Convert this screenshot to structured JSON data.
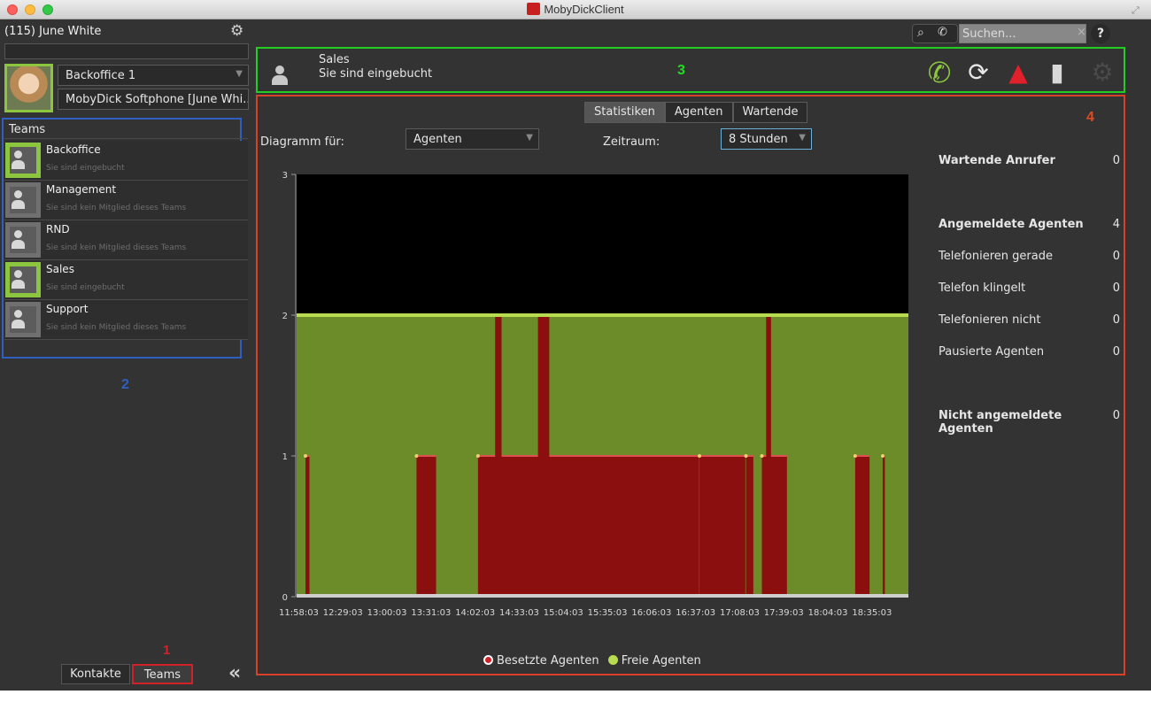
{
  "app": {
    "title": "MobyDickClient"
  },
  "sidebar": {
    "user_name": "(115) June White",
    "group_select": "Backoffice 1",
    "phone_select": "MobyDick Softphone [June Whi...",
    "teams_header": "Teams",
    "teams": [
      {
        "name": "Backoffice",
        "status": "Sie sind eingebucht",
        "active": true
      },
      {
        "name": "Management",
        "status": "Sie sind kein Mitglied dieses Teams",
        "active": false
      },
      {
        "name": "RND",
        "status": "Sie sind kein Mitglied dieses Teams",
        "active": false
      },
      {
        "name": "Sales",
        "status": "Sie sind eingebucht",
        "active": true
      },
      {
        "name": "Support",
        "status": "Sie sind kein Mitglied dieses Teams",
        "active": false
      }
    ],
    "annotation_2": "2",
    "annotation_1": "1",
    "tab_kontakte": "Kontakte",
    "tab_teams": "Teams"
  },
  "toolbar": {
    "search_placeholder": "Suchen...",
    "help": "?"
  },
  "team_panel": {
    "name": "Sales",
    "status": "Sie sind eingebucht",
    "annotation_3": "3"
  },
  "stats_panel": {
    "annotation_4": "4",
    "tabs": [
      "Statistiken",
      "Agenten",
      "Wartende"
    ],
    "active_tab": "Statistiken",
    "diagram_label": "Diagramm für:",
    "diagram_value": "Agenten",
    "range_label": "Zeitraum:",
    "range_value": "8 Stunden",
    "stats": [
      {
        "label": "Wartende Anrufer",
        "value": "0",
        "bold": true
      },
      {
        "label": "Angemeldete Agenten",
        "value": "4",
        "bold": true
      },
      {
        "label": "Telefonieren gerade",
        "value": "0",
        "bold": false
      },
      {
        "label": "Telefon klingelt",
        "value": "0",
        "bold": false
      },
      {
        "label": "Telefonieren nicht",
        "value": "0",
        "bold": false
      },
      {
        "label": "Pausierte Agenten",
        "value": "0",
        "bold": false
      },
      {
        "label": "Nicht angemeldete Agenten",
        "value": "0",
        "bold": true
      }
    ],
    "legend_busy": "Besetzte Agenten",
    "legend_free": "Freie Agenten"
  },
  "chart_data": {
    "type": "area",
    "x_ticks": [
      "11:58:03",
      "12:29:03",
      "13:00:03",
      "13:31:03",
      "14:02:03",
      "14:33:03",
      "15:04:03",
      "15:35:03",
      "16:06:03",
      "16:37:03",
      "17:08:03",
      "17:39:03",
      "18:04:03",
      "18:35:03"
    ],
    "y_ticks": [
      "0",
      "1",
      "2",
      "3"
    ],
    "ylim": [
      0,
      3
    ],
    "colors": {
      "free": "#6b8c28",
      "busy": "#8b0f0f",
      "free_line": "#b8dc50",
      "busy_line": "#e05050"
    },
    "series": [
      {
        "name": "Freie Agenten",
        "constant": 2
      },
      {
        "name": "Besetzte Agenten",
        "segments": [
          [
            0.0145,
            0.021,
            1
          ],
          [
            0.196,
            0.228,
            1
          ],
          [
            0.2965,
            0.658,
            1
          ],
          [
            0.6585,
            0.7335,
            1
          ],
          [
            0.7345,
            0.7465,
            1
          ],
          [
            0.7605,
            0.8015,
            1
          ],
          [
            0.913,
            0.9365,
            1
          ],
          [
            0.958,
            0.9615,
            1
          ],
          [
            0.3245,
            0.335,
            2
          ],
          [
            0.3945,
            0.413,
            2
          ],
          [
            0.7675,
            0.7755,
            2
          ]
        ]
      }
    ]
  }
}
